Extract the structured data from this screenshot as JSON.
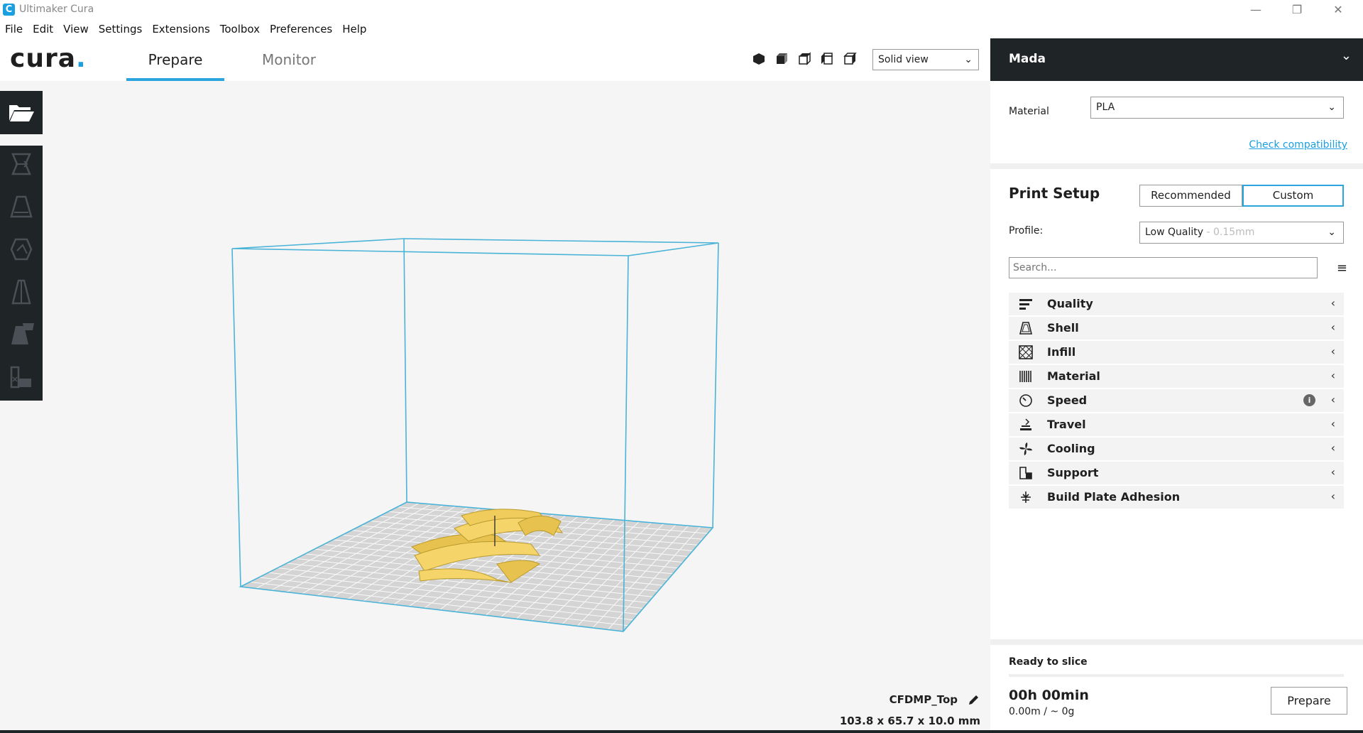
{
  "window": {
    "title": "Ultimaker Cura",
    "controls": [
      "—",
      "❐",
      "✕"
    ]
  },
  "menu": [
    "File",
    "Edit",
    "View",
    "Settings",
    "Extensions",
    "Toolbox",
    "Preferences",
    "Help"
  ],
  "header": {
    "logo_text": "cura",
    "logo_dot": ".",
    "tabs": {
      "prepare": "Prepare",
      "monitor": "Monitor"
    },
    "view_mode": "Solid view"
  },
  "viewport": {
    "object_name": "CFDMP_Top",
    "dimensions": "103.8 x 65.7 x 10.0 mm"
  },
  "sidebar": {
    "machine": "Mada",
    "material_label": "Material",
    "material_value": "PLA",
    "check_compat": "Check compatibility",
    "print_setup": "Print Setup",
    "mode_recommended": "Recommended",
    "mode_custom": "Custom",
    "profile_label": "Profile:",
    "profile_value": "Low Quality",
    "profile_suffix": " - 0.15mm",
    "search_placeholder": "Search...",
    "categories": [
      "Quality",
      "Shell",
      "Infill",
      "Material",
      "Speed",
      "Travel",
      "Cooling",
      "Support",
      "Build Plate Adhesion"
    ],
    "speed_info": "i",
    "status": "Ready to slice",
    "time": "00h 00min",
    "usage": "0.00m / ~ 0g",
    "prepare_button": "Prepare"
  },
  "colors": {
    "accent": "#2ca5df",
    "dark": "#1f2427",
    "model": "#f5d46a",
    "volume": "#4ab3d8"
  }
}
